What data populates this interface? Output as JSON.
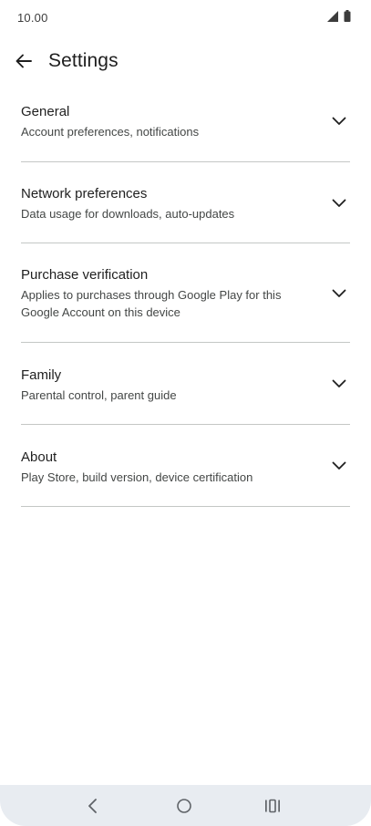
{
  "status_bar": {
    "time": "10.00",
    "icons": [
      "signal-icon",
      "battery-icon"
    ]
  },
  "app_bar": {
    "back_icon": "arrow-back-icon",
    "title": "Settings"
  },
  "settings": {
    "items": [
      {
        "title": "General",
        "subtitle": "Account preferences, notifications",
        "icon": "chevron-down-icon"
      },
      {
        "title": "Network preferences",
        "subtitle": "Data usage for downloads, auto-updates",
        "icon": "chevron-down-icon"
      },
      {
        "title": "Purchase verification",
        "subtitle": "Applies to purchases through Google Play for this Google Account on this device",
        "icon": "chevron-down-icon"
      },
      {
        "title": "Family",
        "subtitle": "Parental control, parent guide",
        "icon": "chevron-down-icon"
      },
      {
        "title": "About",
        "subtitle": "Play Store, build version, device certification",
        "icon": "chevron-down-icon"
      }
    ]
  },
  "nav_bar": {
    "buttons": [
      "back-nav-icon",
      "home-nav-icon",
      "recents-nav-icon"
    ]
  },
  "colors": {
    "text_primary": "#1f1f1f",
    "text_secondary": "#444746",
    "divider": "#c4c7c5",
    "nav_bar_bg": "#e8ecf1"
  }
}
